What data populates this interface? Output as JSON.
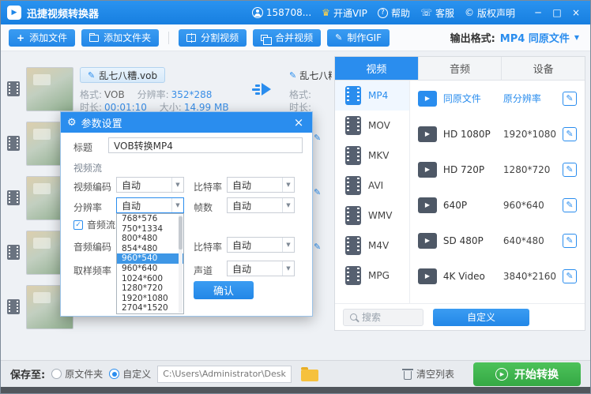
{
  "titlebar": {
    "app_title": "迅捷视频转换器",
    "account": "158708...",
    "vip": "开通VIP",
    "help": "帮助",
    "support": "客服",
    "copyright": "版权声明"
  },
  "toolbar": {
    "add_file": "添加文件",
    "add_folder": "添加文件夹",
    "split_video": "分割视频",
    "merge_video": "合并视频",
    "make_gif": "制作GIF",
    "output_format_label": "输出格式:",
    "output_format_value": "MP4 同原文件"
  },
  "file_item": {
    "name": "乱七八糟.vob",
    "format_label": "格式:",
    "format_value": "VOB",
    "resolution_label": "分辨率:",
    "resolution_value": "352*288",
    "duration_label": "时长:",
    "duration_value": "00:01:10",
    "size_label": "大小:",
    "size_value": "14.99 MB",
    "output_name": "乱七八糟.vob",
    "output_format_label": "格式:",
    "output_duration_label": "时长:"
  },
  "dialog": {
    "title": "参数设置",
    "field_title_label": "标题",
    "field_title_value": "VOB转换MP4",
    "video_stream_label": "视频流",
    "video_codec_label": "视频编码",
    "video_codec_value": "自动",
    "bitrate_label": "比特率",
    "bitrate_value": "自动",
    "resolution_label": "分辨率",
    "resolution_value": "自动",
    "framerate_label": "帧数",
    "framerate_value": "自动",
    "audio_stream_label": "音频流",
    "audio_codec_label": "音频编码",
    "audio_bitrate_label": "比特率",
    "audio_bitrate_value": "自动",
    "sample_rate_label": "取样频率",
    "channel_label": "声道",
    "channel_value": "自动",
    "confirm_label": "确认",
    "resolution_options": [
      "768*576",
      "750*1334",
      "800*480",
      "854*480",
      "960*540",
      "960*640",
      "1024*600",
      "1280*720",
      "1920*1080",
      "2704*1520"
    ],
    "selected_option": "960*540"
  },
  "format_panel": {
    "tabs": {
      "video": "视频",
      "audio": "音频",
      "device": "设备"
    },
    "formats": [
      "MP4",
      "MOV",
      "MKV",
      "AVI",
      "WMV",
      "M4V",
      "MPG"
    ],
    "presets": [
      {
        "name": "同原文件",
        "value": "原分辨率"
      },
      {
        "name": "HD 1080P",
        "value": "1920*1080"
      },
      {
        "name": "HD 720P",
        "value": "1280*720"
      },
      {
        "name": "640P",
        "value": "960*640"
      },
      {
        "name": "SD 480P",
        "value": "640*480"
      },
      {
        "name": "4K Video",
        "value": "3840*2160"
      }
    ],
    "search_placeholder": "搜索",
    "custom_button": "自定义"
  },
  "bottom_bar": {
    "save_to_label": "保存至:",
    "radio_original": "原文件夹",
    "radio_custom": "自定义",
    "path": "C:\\Users\\Administrator\\Desktop",
    "clear_list": "清空列表",
    "start_convert": "开始转换"
  },
  "icons": {
    "play": "▶",
    "pencil": "✎",
    "plus": "+",
    "gear": "⚙",
    "check": "✓",
    "dropdown_arrow": "▼",
    "minimize": "─",
    "maximize": "□",
    "close": "×",
    "vip_crown": "♛",
    "support_phone": "☏",
    "copyright_mark": "©",
    "help_mark": "?"
  },
  "colors": {
    "titlebar_blue": "#1d86e8",
    "accent_blue": "#2a8dee",
    "start_green": "#3eb549"
  }
}
